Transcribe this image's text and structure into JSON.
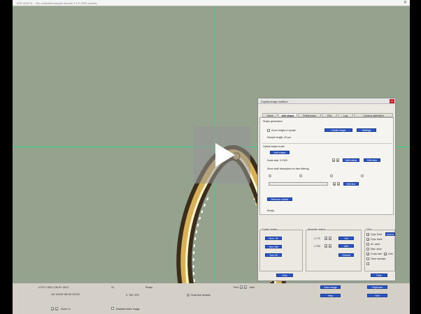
{
  "window": {
    "title": "AJS 2023.01 - Clip controlled sample shooter 3.1.0.2023 (hostid)",
    "close_glyph": "✕"
  },
  "dialog": {
    "title": "Crystal shape toolbox",
    "close_glyph": "x",
    "tabs": [
      "Views",
      "Add shape",
      "Preferences",
      "Plot",
      "Log",
      "Camera calibration"
    ],
    "active_tab": 1,
    "shape_generation": {
      "header": "Shape generation",
      "zoom_check": "Zoom height of crystal",
      "create_button": "Create shape",
      "settings_button": "Settings",
      "sample_length": "Sample length: 40 µm"
    },
    "optical": {
      "header": "Optical shape scale",
      "add_button": "Add shape",
      "scale_label": "Scale step: 0.0100",
      "edit_button": "Edit button",
      "edit_step_button": "Edit step",
      "show_line": "Show shell description for item filtering",
      "edit_line_button": "Edit line"
    },
    "remove_button": "Remove crystal",
    "ready": "Ready",
    "crystal_motion": {
      "header": "Crystal motion",
      "buttons": [
        "Num. 90",
        "Turn 180",
        "Turn 90"
      ]
    },
    "absolute": {
      "header": "Absolute motion",
      "val1": "1.770",
      "val2": "1.760",
      "btn_set": "Set",
      "btn_add": "Add",
      "btn_default": "Default"
    },
    "view_opts": {
      "header": "View",
      "items": [
        "Crys. front",
        "Crys. back",
        "Ax. area",
        "Max. area",
        "Cross hair",
        "Face normals"
      ],
      "extra": "Grid",
      "options_button": "Options"
    },
    "help_button": "Help",
    "help_button2": "Help"
  },
  "status": {
    "coords": "0.372 1.353 0.130 0Y 100.0",
    "coords2": "Lbl: 100.00 100.00 100.00",
    "val_31": "31",
    "ready": "Ready",
    "angle": "Z: 760 \\ 570",
    "draw_label": "Draw true window",
    "prev": "Prev.",
    "next": "Next",
    "save_image": "Save image",
    "help": "Help",
    "clipboard": "Clipboard",
    "exit": "Exit",
    "zoom_label": "Zoom 1x",
    "disable_label": "Disabled video image"
  }
}
